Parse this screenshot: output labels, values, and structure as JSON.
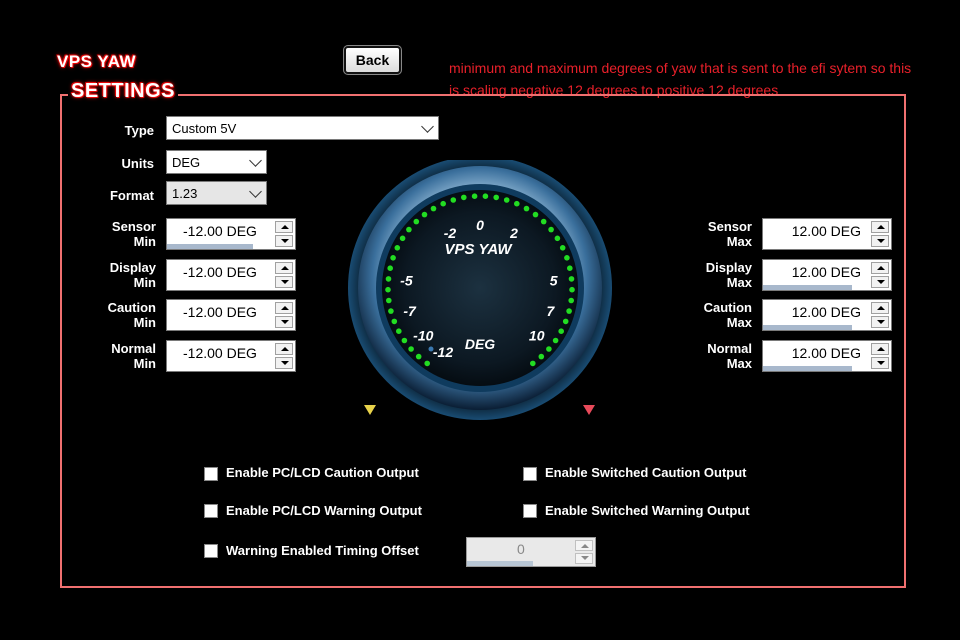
{
  "title": "VPS YAW",
  "back_label": "Back",
  "note": "minimum and maximum degrees of yaw that is sent to the efi sytem so this is scaling negative 12 degrees to positive 12 degrees",
  "section_label": "SETTINGS",
  "fields": {
    "type": {
      "label": "Type",
      "value": "Custom 5V"
    },
    "units": {
      "label": "Units",
      "value": "DEG"
    },
    "format": {
      "label": "Format",
      "value": "1.23"
    }
  },
  "left_spins": [
    {
      "label1": "Sensor",
      "label2": "Min",
      "value": "-12.00 DEG",
      "fill": 0.8
    },
    {
      "label1": "Display",
      "label2": "Min",
      "value": "-12.00 DEG",
      "fill": 0
    },
    {
      "label1": "Caution",
      "label2": "Min",
      "value": "-12.00 DEG",
      "fill": 0
    },
    {
      "label1": "Normal",
      "label2": "Min",
      "value": "-12.00 DEG",
      "fill": 0
    }
  ],
  "right_spins": [
    {
      "label1": "Sensor",
      "label2": "Max",
      "value": "12.00 DEG",
      "fill": 0
    },
    {
      "label1": "Display",
      "label2": "Max",
      "value": "12.00 DEG",
      "fill": 0.82
    },
    {
      "label1": "Caution",
      "label2": "Max",
      "value": "12.00 DEG",
      "fill": 0.82
    },
    {
      "label1": "Normal",
      "label2": "Max",
      "value": "12.00 DEG",
      "fill": 0.82
    }
  ],
  "gauge": {
    "title": "VPS YAW",
    "unit": "DEG",
    "ticks": [
      "-12",
      "-10",
      "-7",
      "-5",
      "-2",
      "0",
      "2",
      "5",
      "7",
      "10"
    ],
    "accent_color": "#22dd22"
  },
  "checkboxes": {
    "pc_lcd_caution": "Enable PC/LCD Caution Output",
    "switched_caution": "Enable Switched Caution Output",
    "pc_lcd_warning": "Enable PC/LCD Warning Output",
    "switched_warning": "Enable Switched Warning Output",
    "warning_timing": "Warning Enabled Timing Offset"
  },
  "timing_offset_value": "0"
}
